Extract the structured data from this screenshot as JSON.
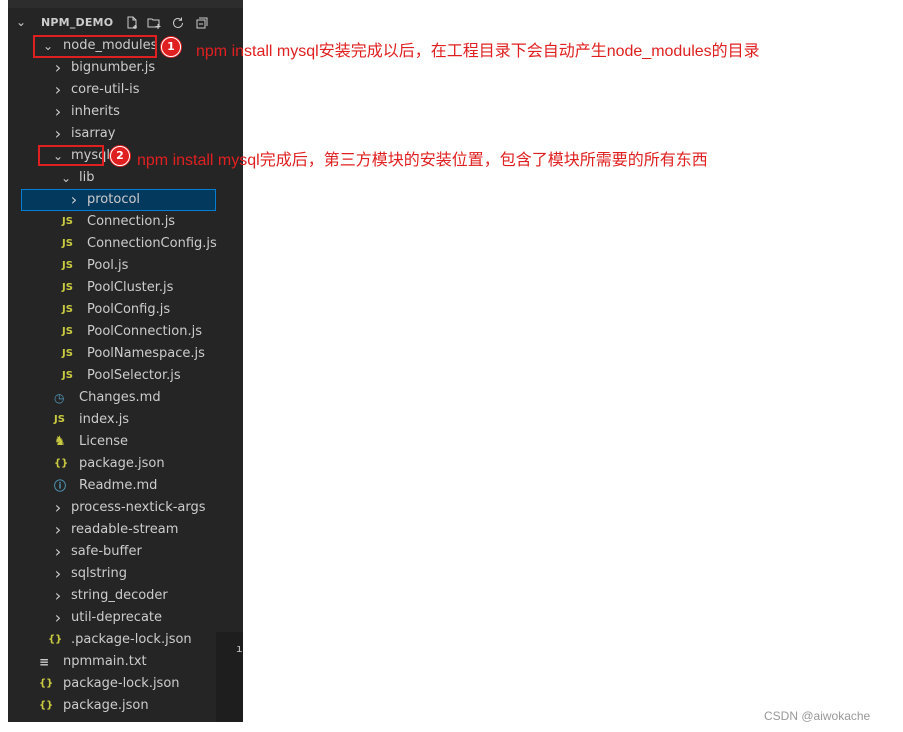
{
  "explorer": {
    "title": "NPM_DEMO",
    "header_icons": [
      "new-file-icon",
      "new-folder-icon",
      "refresh-icon",
      "collapse-all-icon"
    ],
    "rows": [
      {
        "label": "node_modules",
        "kind": "folder-open",
        "indent": 0
      },
      {
        "label": "bignumber.js",
        "kind": "folder-closed",
        "indent": 1
      },
      {
        "label": "core-util-is",
        "kind": "folder-closed",
        "indent": 1
      },
      {
        "label": "inherits",
        "kind": "folder-closed",
        "indent": 1
      },
      {
        "label": "isarray",
        "kind": "folder-closed",
        "indent": 1
      },
      {
        "label": "mysql",
        "kind": "folder-open",
        "indent": 1
      },
      {
        "label": "lib",
        "kind": "folder-open",
        "indent": 2
      },
      {
        "label": "protocol",
        "kind": "folder-closed",
        "indent": 3,
        "selected": true
      },
      {
        "label": "Connection.js",
        "kind": "js",
        "indent": 3
      },
      {
        "label": "ConnectionConfig.js",
        "kind": "js",
        "indent": 3
      },
      {
        "label": "Pool.js",
        "kind": "js",
        "indent": 3
      },
      {
        "label": "PoolCluster.js",
        "kind": "js",
        "indent": 3
      },
      {
        "label": "PoolConfig.js",
        "kind": "js",
        "indent": 3
      },
      {
        "label": "PoolConnection.js",
        "kind": "js",
        "indent": 3
      },
      {
        "label": "PoolNamespace.js",
        "kind": "js",
        "indent": 3
      },
      {
        "label": "PoolSelector.js",
        "kind": "js",
        "indent": 3
      },
      {
        "label": "Changes.md",
        "kind": "md-clock",
        "indent": 2
      },
      {
        "label": "index.js",
        "kind": "js",
        "indent": 2
      },
      {
        "label": "License",
        "kind": "license",
        "indent": 2
      },
      {
        "label": "package.json",
        "kind": "json",
        "indent": 2
      },
      {
        "label": "Readme.md",
        "kind": "md-info",
        "indent": 2
      },
      {
        "label": "process-nextick-args",
        "kind": "folder-closed",
        "indent": 1
      },
      {
        "label": "readable-stream",
        "kind": "folder-closed",
        "indent": 1
      },
      {
        "label": "safe-buffer",
        "kind": "folder-closed",
        "indent": 1
      },
      {
        "label": "sqlstring",
        "kind": "folder-closed",
        "indent": 1
      },
      {
        "label": "string_decoder",
        "kind": "folder-closed",
        "indent": 1
      },
      {
        "label": "util-deprecate",
        "kind": "folder-closed",
        "indent": 1
      },
      {
        "label": ".package-lock.json",
        "kind": "json",
        "indent": 1
      },
      {
        "label": "npmmain.txt",
        "kind": "txt",
        "indent": 0
      },
      {
        "label": "package-lock.json",
        "kind": "json",
        "indent": 0
      },
      {
        "label": "package.json",
        "kind": "json",
        "indent": 0
      }
    ]
  },
  "glyphs": {
    "chevron_down": "⌄",
    "chevron_right": "›",
    "js": "JS",
    "json": "{}",
    "txt": "≡",
    "license": "♞",
    "info": "ⓘ",
    "clock": "◷"
  },
  "annotations": {
    "badge_1": "1",
    "note_1": "npm install mysql安装完成以后，在工程目录下会自动产生node_modules的目录",
    "badge_2": "2",
    "note_2": "npm install mysql完成后，第三方模块的安装位置，包含了模块所需要的所有东西"
  },
  "watermark": "CSDN @aiwokache",
  "colors": {
    "sidebar_bg": "#252526",
    "annotation_red": "#e02020",
    "selection_bg": "#04395e",
    "selection_border": "#007fd4",
    "js_yellow": "#cbcb41"
  }
}
